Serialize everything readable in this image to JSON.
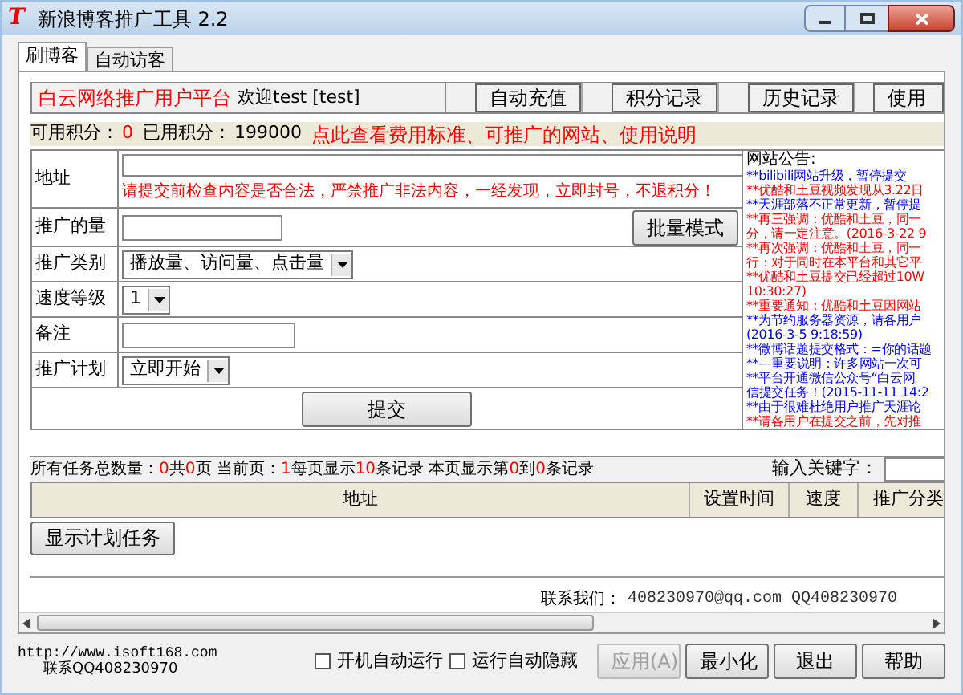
{
  "window": {
    "logo": "T",
    "title": "新浪博客推广工具 2.2"
  },
  "tabs": [
    {
      "label": "刷博客",
      "selected": true
    },
    {
      "label": "自动访客",
      "selected": false
    }
  ],
  "header": {
    "platform": "白云网络推广用户平台",
    "welcome": "欢迎test [test]",
    "buttons": [
      "自动充值",
      "积分记录",
      "历史记录",
      "使用"
    ]
  },
  "credits": {
    "available_label": "可用积分：",
    "available": "0",
    "used_label": "已用积分：",
    "used": "199000",
    "link": "点此查看费用标准、可推广的网站、使用说明"
  },
  "form": {
    "address_label": "地址",
    "warning": "请提交前检查内容是否合法，严禁推广非法内容，一经发现，立即封号，不退积分！",
    "amount_label": "推广的量",
    "batch_button": "批量模式",
    "category_label": "推广类别",
    "category": "播放量、访问量、点击量",
    "speed_label": "速度等级",
    "speed": "1",
    "note_label": "备注",
    "plan_label": "推广计划",
    "plan": "立即开始",
    "submit": "提交"
  },
  "notice": {
    "title": "网站公告:",
    "lines": [
      {
        "text": "**bilibili网站升级，暂停提交",
        "color": "#0000ff"
      },
      {
        "text": "**优酷和土豆视频发现从3.22日",
        "color": "#ff0000"
      },
      {
        "text": "**天涯部落不正常更新，暂停提",
        "color": "#0000ff"
      },
      {
        "text": "**再三强调：优酷和土豆，同一",
        "color": "#ff0000"
      },
      {
        "text": "分，请一定注意。(2016-3-22 9",
        "color": "#ff0000"
      },
      {
        "text": "**再次强调：优酷和土豆，同一",
        "color": "#ff0000"
      },
      {
        "text": "行：对于同时在本平台和其它平",
        "color": "#ff0000"
      },
      {
        "text": "**优酷和土豆提交已经超过10W",
        "color": "#ff0000"
      },
      {
        "text": "10:30:27)",
        "color": "#ff0000"
      },
      {
        "text": "**重要通知：优酷和土豆因网站",
        "color": "#ff0000"
      },
      {
        "text": "**为节约服务器资源，请各用户",
        "color": "#0000ff"
      },
      {
        "text": "(2016-3-5 9:18:59)",
        "color": "#0000ff"
      },
      {
        "text": "**微博话题提交格式：=你的话题",
        "color": "#0000ff"
      },
      {
        "text": "**---重要说明：许多网站一次可",
        "color": "#0000ff"
      },
      {
        "text": "**平台开通微信公众号“白云网",
        "color": "#0000ff"
      },
      {
        "text": "信提交任务！(2015-11-11 14:2",
        "color": "#0000ff"
      },
      {
        "text": "**由于很难杜绝用户推广天涯论",
        "color": "#0000ff"
      },
      {
        "text": "**请各用户在提交之前，先对推",
        "color": "#ff0000"
      }
    ]
  },
  "stats": {
    "segments": [
      {
        "text": "所有任务总数量：",
        "kind": "label"
      },
      {
        "text": "0",
        "kind": "value"
      },
      {
        "text": "共",
        "kind": "label"
      },
      {
        "text": "0",
        "kind": "value"
      },
      {
        "text": "页 当前页：",
        "kind": "label"
      },
      {
        "text": "1",
        "kind": "value"
      },
      {
        "text": "每页显示",
        "kind": "label"
      },
      {
        "text": "10",
        "kind": "value"
      },
      {
        "text": "条记录 本页显示第",
        "kind": "label"
      },
      {
        "text": "0",
        "kind": "value"
      },
      {
        "text": "到",
        "kind": "label"
      },
      {
        "text": "0",
        "kind": "value"
      },
      {
        "text": "条记录",
        "kind": "label"
      }
    ],
    "keyword_label": "输入关键字："
  },
  "table": {
    "columns": [
      "地址",
      "设置时间",
      "速度",
      "推广分类"
    ]
  },
  "show_plan_button": "显示计划任务",
  "contact": {
    "label": "联系我们：",
    "value": "408230970@qq.com QQ408230970"
  },
  "footer": {
    "url": "http://www.isoft168.com",
    "qq": "联系QQ408230970",
    "checkboxes": [
      {
        "label": "开机自动运行",
        "checked": false
      },
      {
        "label": "运行自动隐藏",
        "checked": false
      }
    ],
    "buttons": [
      {
        "label": "应用(A)",
        "disabled": true
      },
      {
        "label": "最小化",
        "disabled": false
      },
      {
        "label": "退出",
        "disabled": false
      },
      {
        "label": "帮助",
        "disabled": false
      }
    ]
  }
}
